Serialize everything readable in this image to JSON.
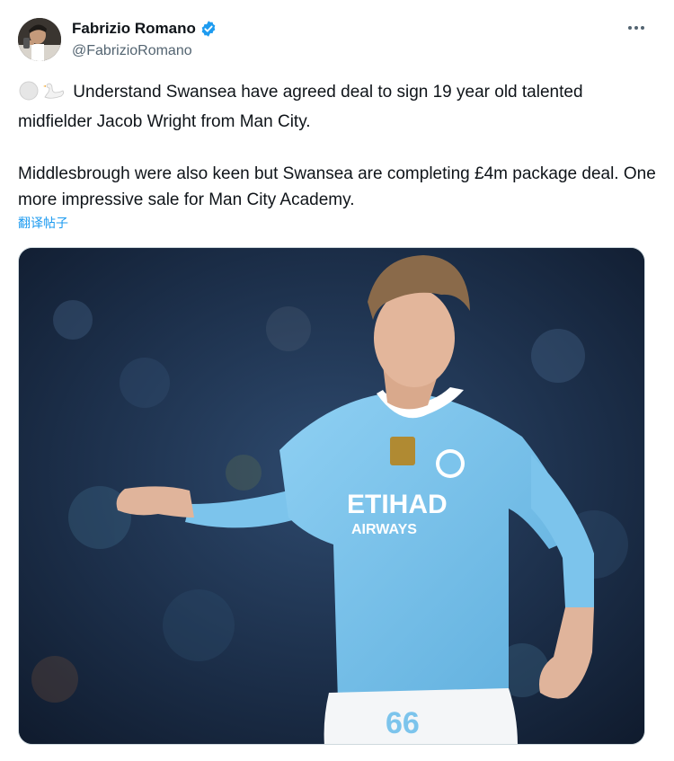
{
  "author": {
    "display_name": "Fabrizio Romano",
    "handle": "@FabrizioRomano",
    "verified": true
  },
  "tweet": {
    "paragraphs": [
      "Understand Swansea have agreed deal to sign 19 year old talented midfielder Jacob Wright from Man City.",
      "Middlesbrough were also keen but Swansea are completing £4m package deal. One more impressive sale for Man City Academy."
    ],
    "emojis": [
      "white-circle-icon",
      "swan-icon"
    ],
    "translate_label": "翻译帖子"
  },
  "media": {
    "shirt_sponsor_line1": "ETIHAD",
    "shirt_sponsor_line2": "AIRWAYS",
    "shirt_number": "66",
    "colors": {
      "shirt": "#7cc4ec",
      "background": "#1b2a40"
    }
  },
  "colors": {
    "accent": "#1d9bf0",
    "text": "#0f1419",
    "secondary": "#536471"
  }
}
